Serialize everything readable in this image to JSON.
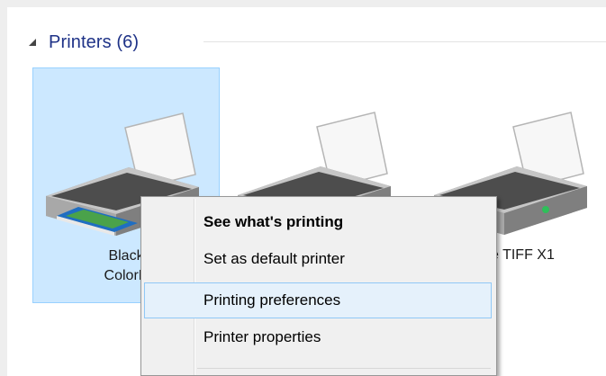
{
  "group": {
    "title": "Printers (6)",
    "collapse_icon": "triangle-expanded-icon"
  },
  "printers": [
    {
      "label_line1": "Black",
      "label_line2": "ColorP"
    },
    {
      "label_line1": "",
      "label_line2": ""
    },
    {
      "label_line1": "c Ice TIFF X1",
      "label_line2": ""
    }
  ],
  "context_menu": {
    "items": [
      {
        "label": "See what's printing"
      },
      {
        "label": "Set as default printer"
      },
      {
        "label": "Printing preferences"
      },
      {
        "label": "Printer properties"
      }
    ]
  },
  "colors": {
    "selection_fill": "#cce8ff",
    "selection_border": "#99d1ff",
    "menu_hover_fill": "#e5f1fb",
    "menu_hover_border": "#90c8f6",
    "group_title": "#1e3287"
  }
}
